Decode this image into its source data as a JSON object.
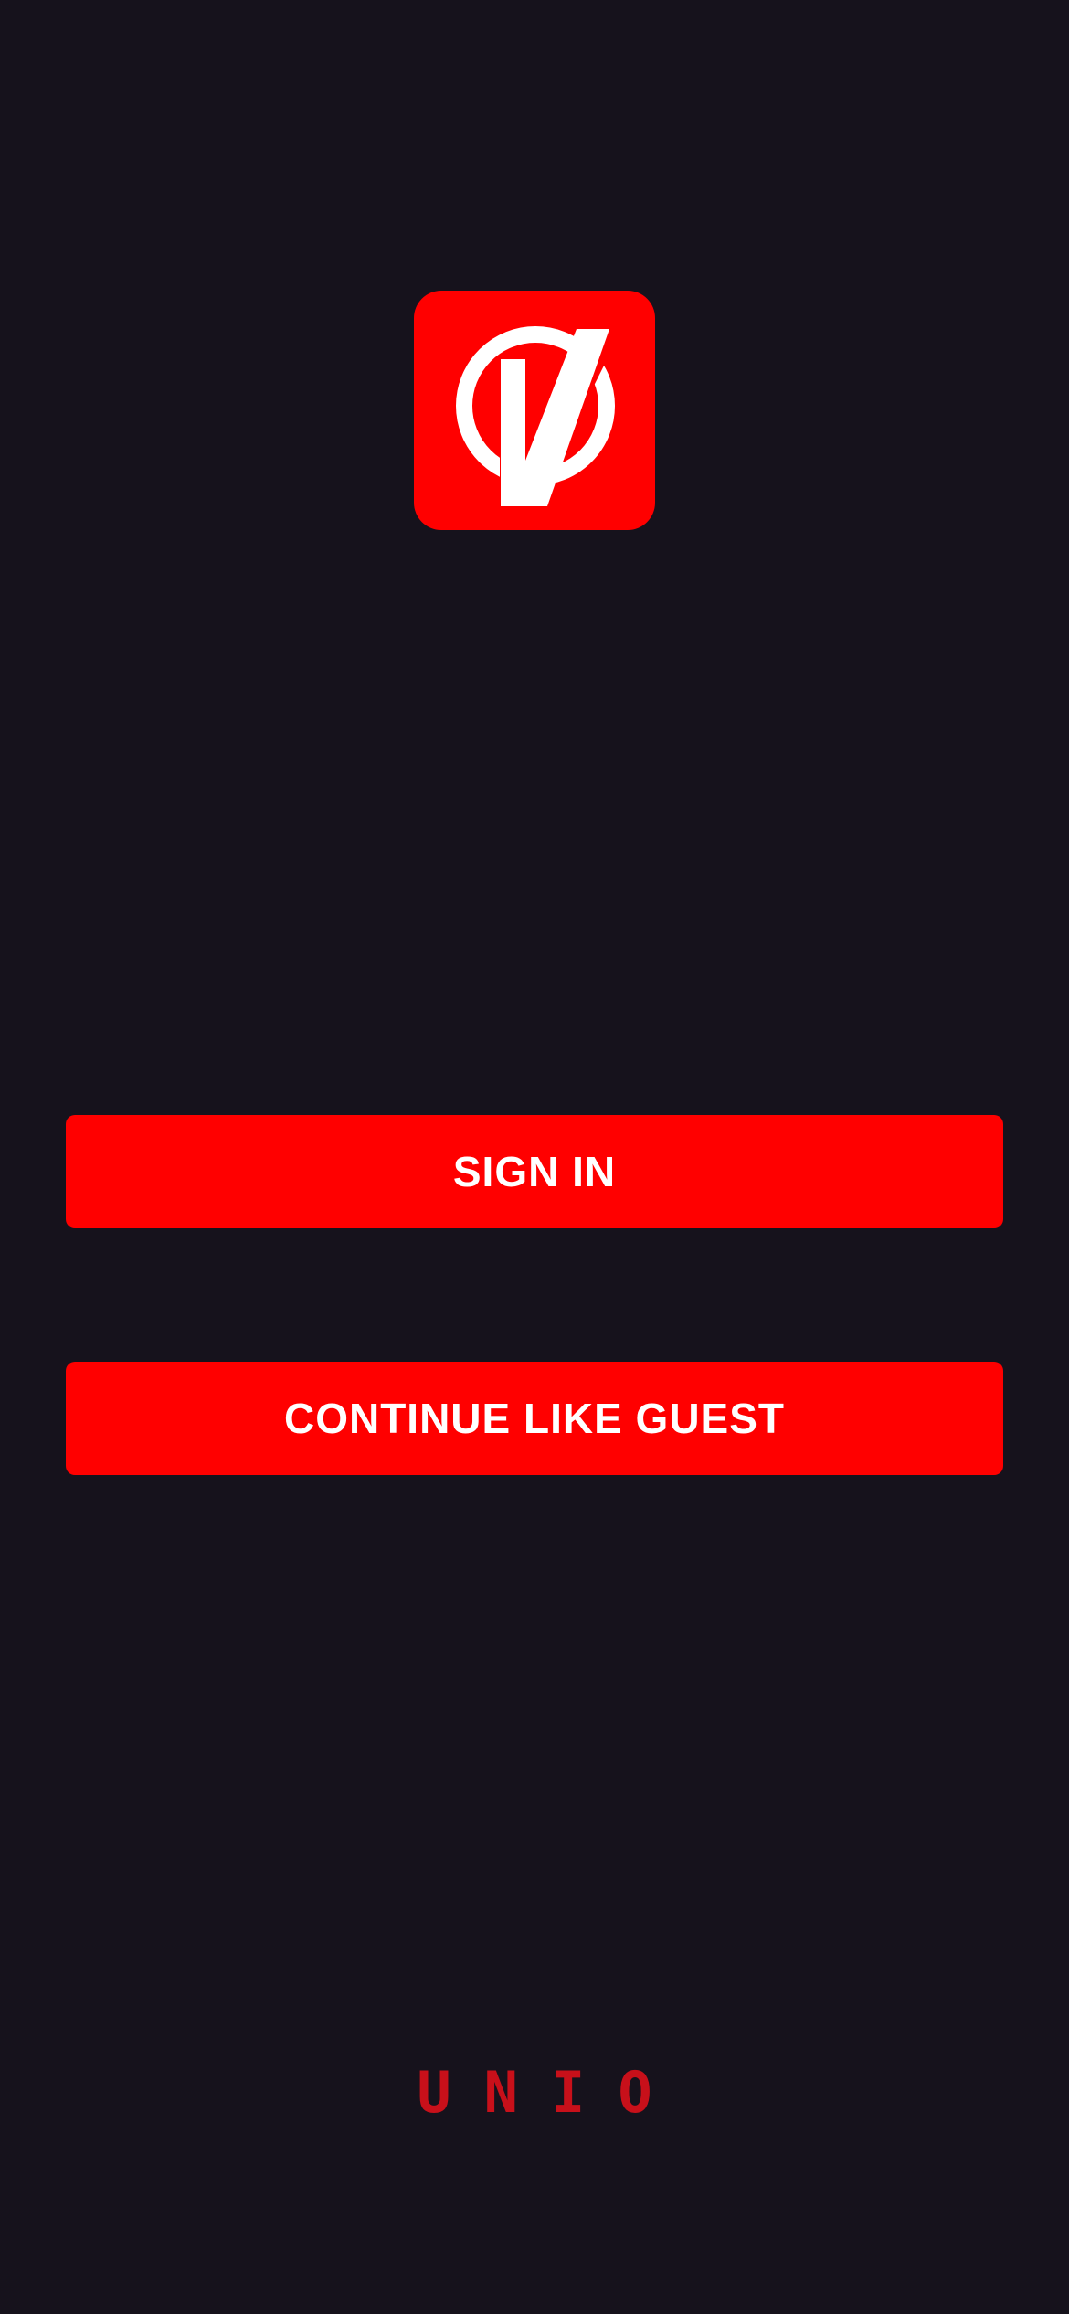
{
  "logo": {
    "icon": "unio-logo-icon",
    "background_color": "#ff0000",
    "mark_color": "#ffffff"
  },
  "actions": {
    "sign_in_label": "SIGN IN",
    "guest_label": "CONTINUE LIKE GUEST"
  },
  "brand": {
    "wordmark": "UNIO"
  },
  "colors": {
    "background": "#16121c",
    "accent": "#ff0000",
    "wordmark": "#c8101a"
  }
}
